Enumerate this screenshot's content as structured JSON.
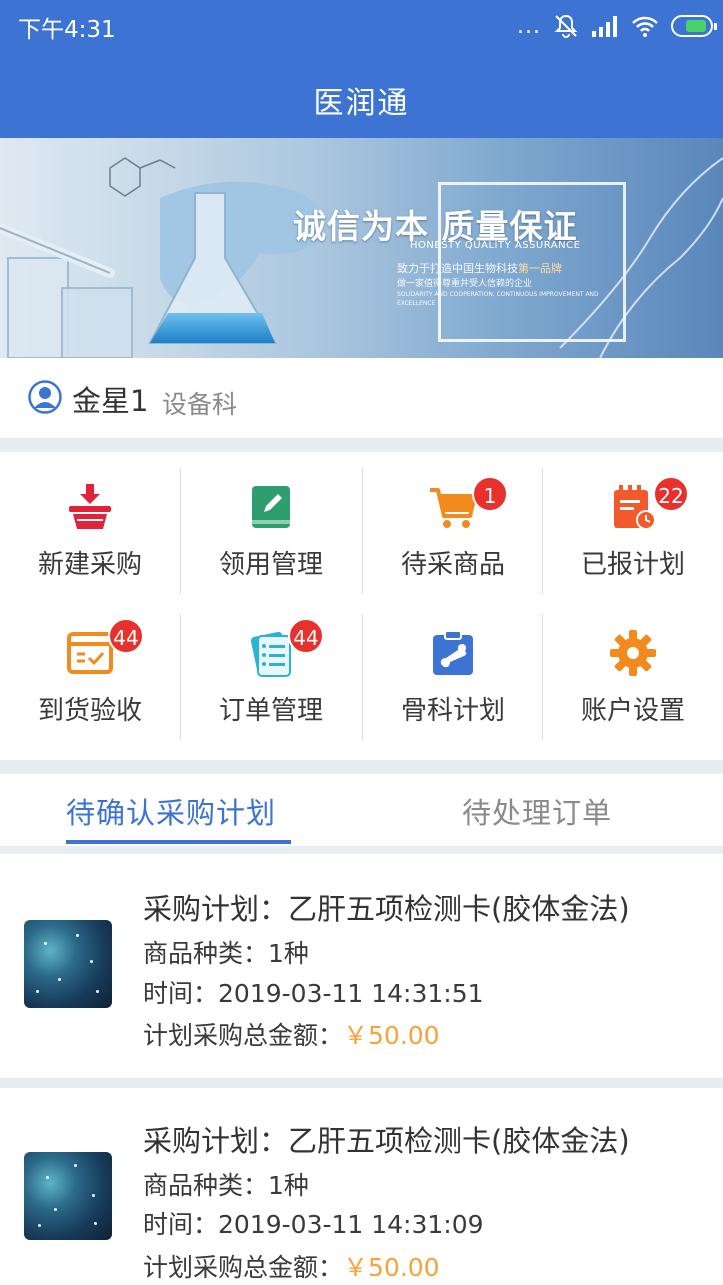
{
  "status_bar": {
    "time": "下午4:31",
    "dots": "..."
  },
  "app": {
    "title": "医润通"
  },
  "banner": {
    "headline": "诚信为本  质量保证",
    "subtitle": "HONESTY QUALITY ASSURANCE",
    "line1_a": "致力于打造中国生物科技",
    "line1_b": "第一品牌",
    "line2": "做一家值得尊重并受人信赖的企业",
    "line3": "SOLIDARITY AND COOPERATION, CONTINUOUS IMPROVEMENT AND EXCELLENCE"
  },
  "user": {
    "name": "金星1",
    "dept": "设备科"
  },
  "menu": [
    {
      "label": "新建采购",
      "icon": "basket-download-icon",
      "badge": ""
    },
    {
      "label": "领用管理",
      "icon": "notebook-edit-icon",
      "badge": ""
    },
    {
      "label": "待采商品",
      "icon": "shopping-cart-icon",
      "badge": "1"
    },
    {
      "label": "已报计划",
      "icon": "calendar-clock-icon",
      "badge": "22"
    },
    {
      "label": "到货验收",
      "icon": "box-check-icon",
      "badge": "44"
    },
    {
      "label": "订单管理",
      "icon": "order-list-icon",
      "badge": "44"
    },
    {
      "label": "骨科计划",
      "icon": "bone-clipboard-icon",
      "badge": ""
    },
    {
      "label": "账户设置",
      "icon": "gear-icon",
      "badge": ""
    }
  ],
  "colors": {
    "primary": "#3d74d3",
    "badge": "#e8312c",
    "amount": "#f5a33a"
  },
  "tabs": [
    {
      "label": "待确认采购计划",
      "active": true
    },
    {
      "label": "待处理订单",
      "active": false
    }
  ],
  "plans": [
    {
      "title": "采购计划：乙肝五项检测卡(胶体金法)",
      "kind_label": "商品种类：",
      "kind": "1种",
      "time_label": "时间：",
      "time": "2019-03-11 14:31:51",
      "amount_label": "计划采购总金额：",
      "amount": "￥50.00"
    },
    {
      "title": "采购计划：乙肝五项检测卡(胶体金法)",
      "kind_label": "商品种类：",
      "kind": "1种",
      "time_label": "时间：",
      "time": "2019-03-11 14:31:09",
      "amount_label": "计划采购总金额：",
      "amount": "￥50.00"
    }
  ]
}
